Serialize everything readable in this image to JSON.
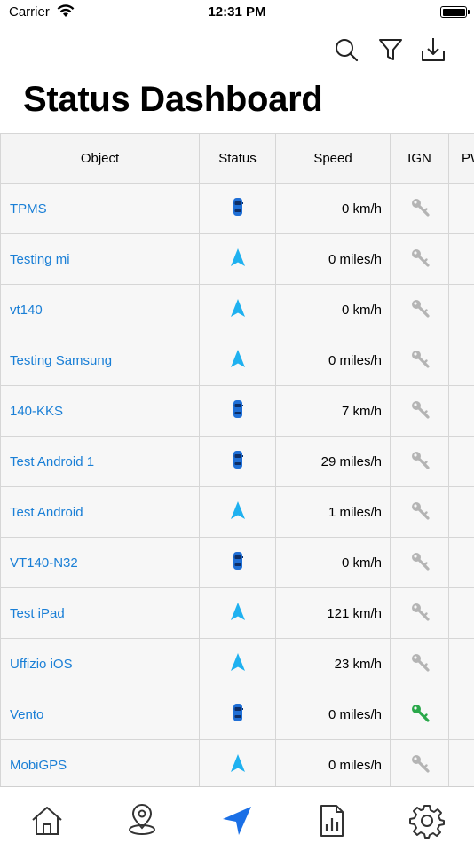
{
  "status_bar": {
    "carrier": "Carrier",
    "time": "12:31 PM"
  },
  "header": {
    "title": "Status Dashboard"
  },
  "toolbar": {
    "search_icon": "search-icon",
    "filter_icon": "filter-icon",
    "download_icon": "download-icon"
  },
  "table": {
    "columns": [
      "Object",
      "Status",
      "Speed",
      "IGN",
      "PW"
    ],
    "rows": [
      {
        "object": "TPMS",
        "status": "car",
        "speed": "0 km/h",
        "ign": "off"
      },
      {
        "object": "Testing mi",
        "status": "arrow",
        "speed": "0 miles/h",
        "ign": "off"
      },
      {
        "object": "vt140",
        "status": "arrow",
        "speed": "0 km/h",
        "ign": "off"
      },
      {
        "object": "Testing Samsung",
        "status": "arrow",
        "speed": "0 miles/h",
        "ign": "off"
      },
      {
        "object": "140-KKS",
        "status": "car",
        "speed": "7 km/h",
        "ign": "off"
      },
      {
        "object": "Test Android 1",
        "status": "car",
        "speed": "29 miles/h",
        "ign": "off"
      },
      {
        "object": "Test Android",
        "status": "arrow",
        "speed": "1 miles/h",
        "ign": "off"
      },
      {
        "object": "VT140-N32",
        "status": "car",
        "speed": "0 km/h",
        "ign": "off"
      },
      {
        "object": "Test iPad",
        "status": "arrow",
        "speed": "121 km/h",
        "ign": "off"
      },
      {
        "object": "Uffizio iOS",
        "status": "arrow",
        "speed": "23 km/h",
        "ign": "off"
      },
      {
        "object": "Vento",
        "status": "car",
        "speed": "0 miles/h",
        "ign": "on"
      },
      {
        "object": "MobiGPS",
        "status": "arrow",
        "speed": "0 miles/h",
        "ign": "off"
      }
    ]
  },
  "tab_bar": {
    "tabs": [
      {
        "icon": "home-icon",
        "active": false
      },
      {
        "icon": "location-pin-icon",
        "active": false
      },
      {
        "icon": "navigation-arrow-icon",
        "active": true
      },
      {
        "icon": "report-icon",
        "active": false
      },
      {
        "icon": "settings-gear-icon",
        "active": false
      }
    ]
  },
  "colors": {
    "link": "#1a7fd6",
    "active_tab": "#1a6fe6",
    "arrow_status": "#1fb1f0",
    "ign_on": "#2aa84a",
    "ign_off": "#b4b4b4",
    "car": "#1f6fd6"
  }
}
